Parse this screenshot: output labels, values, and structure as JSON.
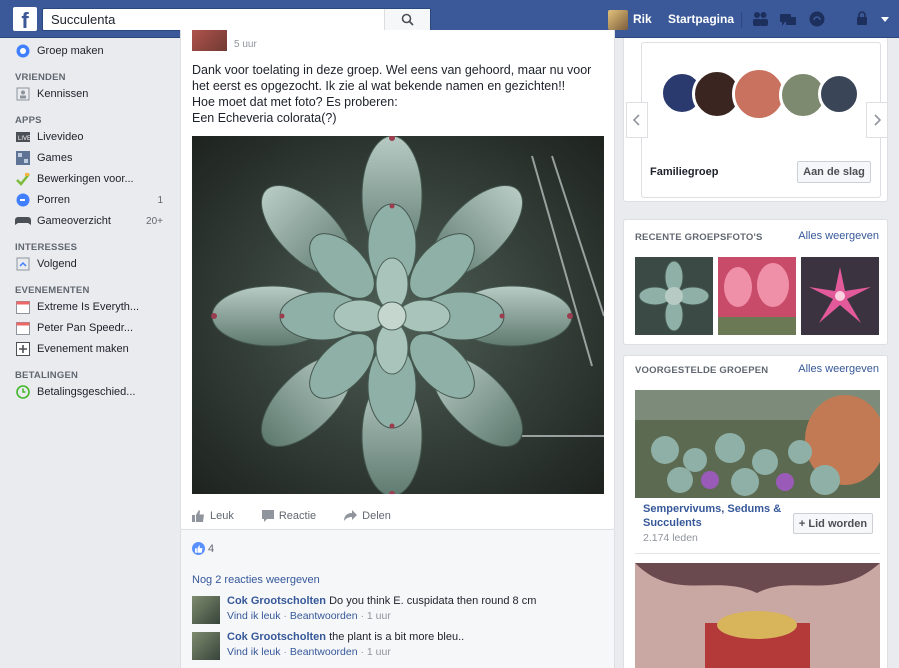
{
  "topbar": {
    "logo": "f",
    "search_value": "Succulenta",
    "user_name": "Rik",
    "home_label": "Startpagina"
  },
  "sidebar": {
    "create_group": "Groep maken",
    "sections": {
      "friends": "VRIENDEN",
      "apps": "APPS",
      "interests": "INTERESSES",
      "events": "EVENEMENTEN",
      "payments": "BETALINGEN"
    },
    "acquaintances": "Kennissen",
    "apps": [
      {
        "label": "Livevideo",
        "icon": "video-icon"
      },
      {
        "label": "Games",
        "icon": "games-icon"
      },
      {
        "label": "Bewerkingen voor...",
        "icon": "edit-icon"
      },
      {
        "label": "Porren",
        "icon": "poke-icon",
        "count": "1"
      },
      {
        "label": "Gameoverzicht",
        "icon": "gamepad-icon",
        "count": "20+"
      }
    ],
    "following": "Volgend",
    "events": [
      {
        "label": "Extreme Is Everyth...",
        "icon": "calendar-icon"
      },
      {
        "label": "Peter Pan Speedr...",
        "icon": "calendar-icon"
      },
      {
        "label": "Evenement maken",
        "icon": "plus-calendar-icon"
      }
    ],
    "payment_history": "Betalingsgeschied..."
  },
  "post": {
    "time": "5 uur",
    "text_lines": [
      "Dank voor toelating in deze groep. Wel eens van gehoord, maar nu voor",
      "het eerst es opgezocht. Ik zie al wat bekende namen en gezichten!!",
      "Hoe moet dat met foto? Es proberen:",
      "Een Echeveria colorata(?)"
    ],
    "actions": {
      "like": "Leuk",
      "comment": "Reactie",
      "share": "Delen"
    },
    "like_count": "4",
    "more_comments": "Nog 2 reacties weergeven",
    "comments": [
      {
        "author": "Cok Grootscholten",
        "text": "Do you think E. cuspidata then round 8 cm",
        "like": "Vind ik leuk",
        "reply": "Beantwoorden",
        "time": "1 uur"
      },
      {
        "author": "Cok Grootscholten",
        "text": "the plant is a bit more bleu..",
        "like": "Vind ik leuk",
        "reply": "Beantwoorden",
        "time": "1 uur"
      }
    ]
  },
  "right": {
    "group_suggestion": {
      "name": "Familiegroep",
      "button": "Aan de slag"
    },
    "recent_photos": {
      "title": "RECENTE GROEPSFOTO'S",
      "link": "Alles weergeven"
    },
    "suggested_groups": {
      "title": "VOORGESTELDE GROEPEN",
      "link": "Alles weergeven",
      "group_name": "Sempervivums, Sedums & Succulents",
      "members": "2.174 leden",
      "join_button": "+ Lid worden"
    }
  },
  "colors": {
    "brand": "#3b5998",
    "link": "#365899",
    "background": "#e9ebee"
  }
}
